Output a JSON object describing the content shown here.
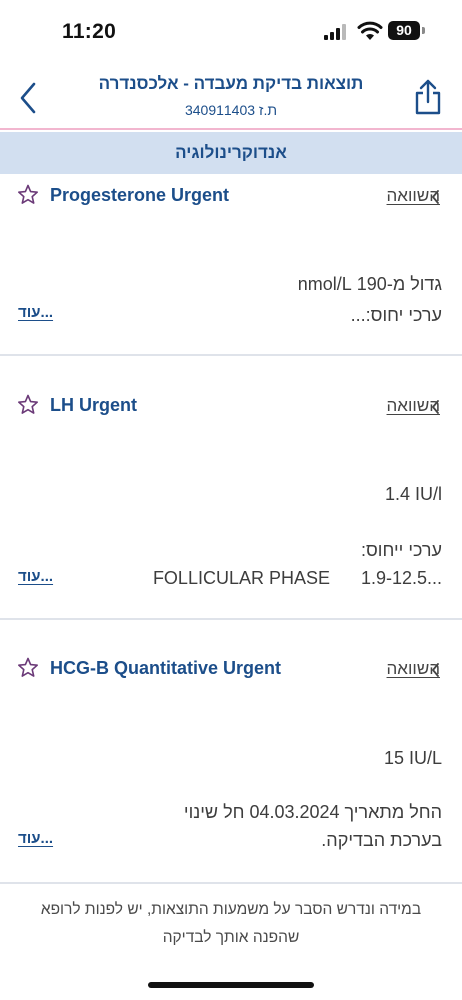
{
  "status_bar": {
    "time": "11:20",
    "battery": "90",
    "icons": [
      "signal-icon",
      "wifi-icon",
      "battery-icon"
    ]
  },
  "header": {
    "title": "תוצאות בדיקת מעבדה - אלכסנדרה",
    "id_line": "ת.ז 340911403",
    "icons": [
      "back-chevron-icon",
      "share-icon"
    ]
  },
  "category": "אנדוקרינולוגיה",
  "compare_label": "השוואה",
  "more_label": "עוד...",
  "results": [
    {
      "name": "Progesterone Urgent",
      "value_line": "גדול מ-190 nmol/L",
      "range_line": "ערכי יחוס:..."
    },
    {
      "name": "LH Urgent",
      "value_line": "1.4 IU/l",
      "range_label": "ערכי ייחוס:",
      "range_phase": "FOLLICULAR PHASE",
      "range_value": "1.9-12.5..."
    },
    {
      "name": "HCG-B Quantitative Urgent",
      "value_line": "15 IU/L",
      "note_line_1": "החל מתאריך 04.03.2024 חל שינוי",
      "note_line_2": "בערכת הבדיקה."
    }
  ],
  "footer_note": "במידה ונדרש הסבר על משמעות התוצאות, יש לפנות לרופא שהפנה אותך לבדיקה",
  "colors": {
    "brand_blue": "#1c4e8a",
    "category_band": "#d2dff0",
    "header_divider": "#f2b6cf",
    "star_outline": "#6b3a78"
  }
}
